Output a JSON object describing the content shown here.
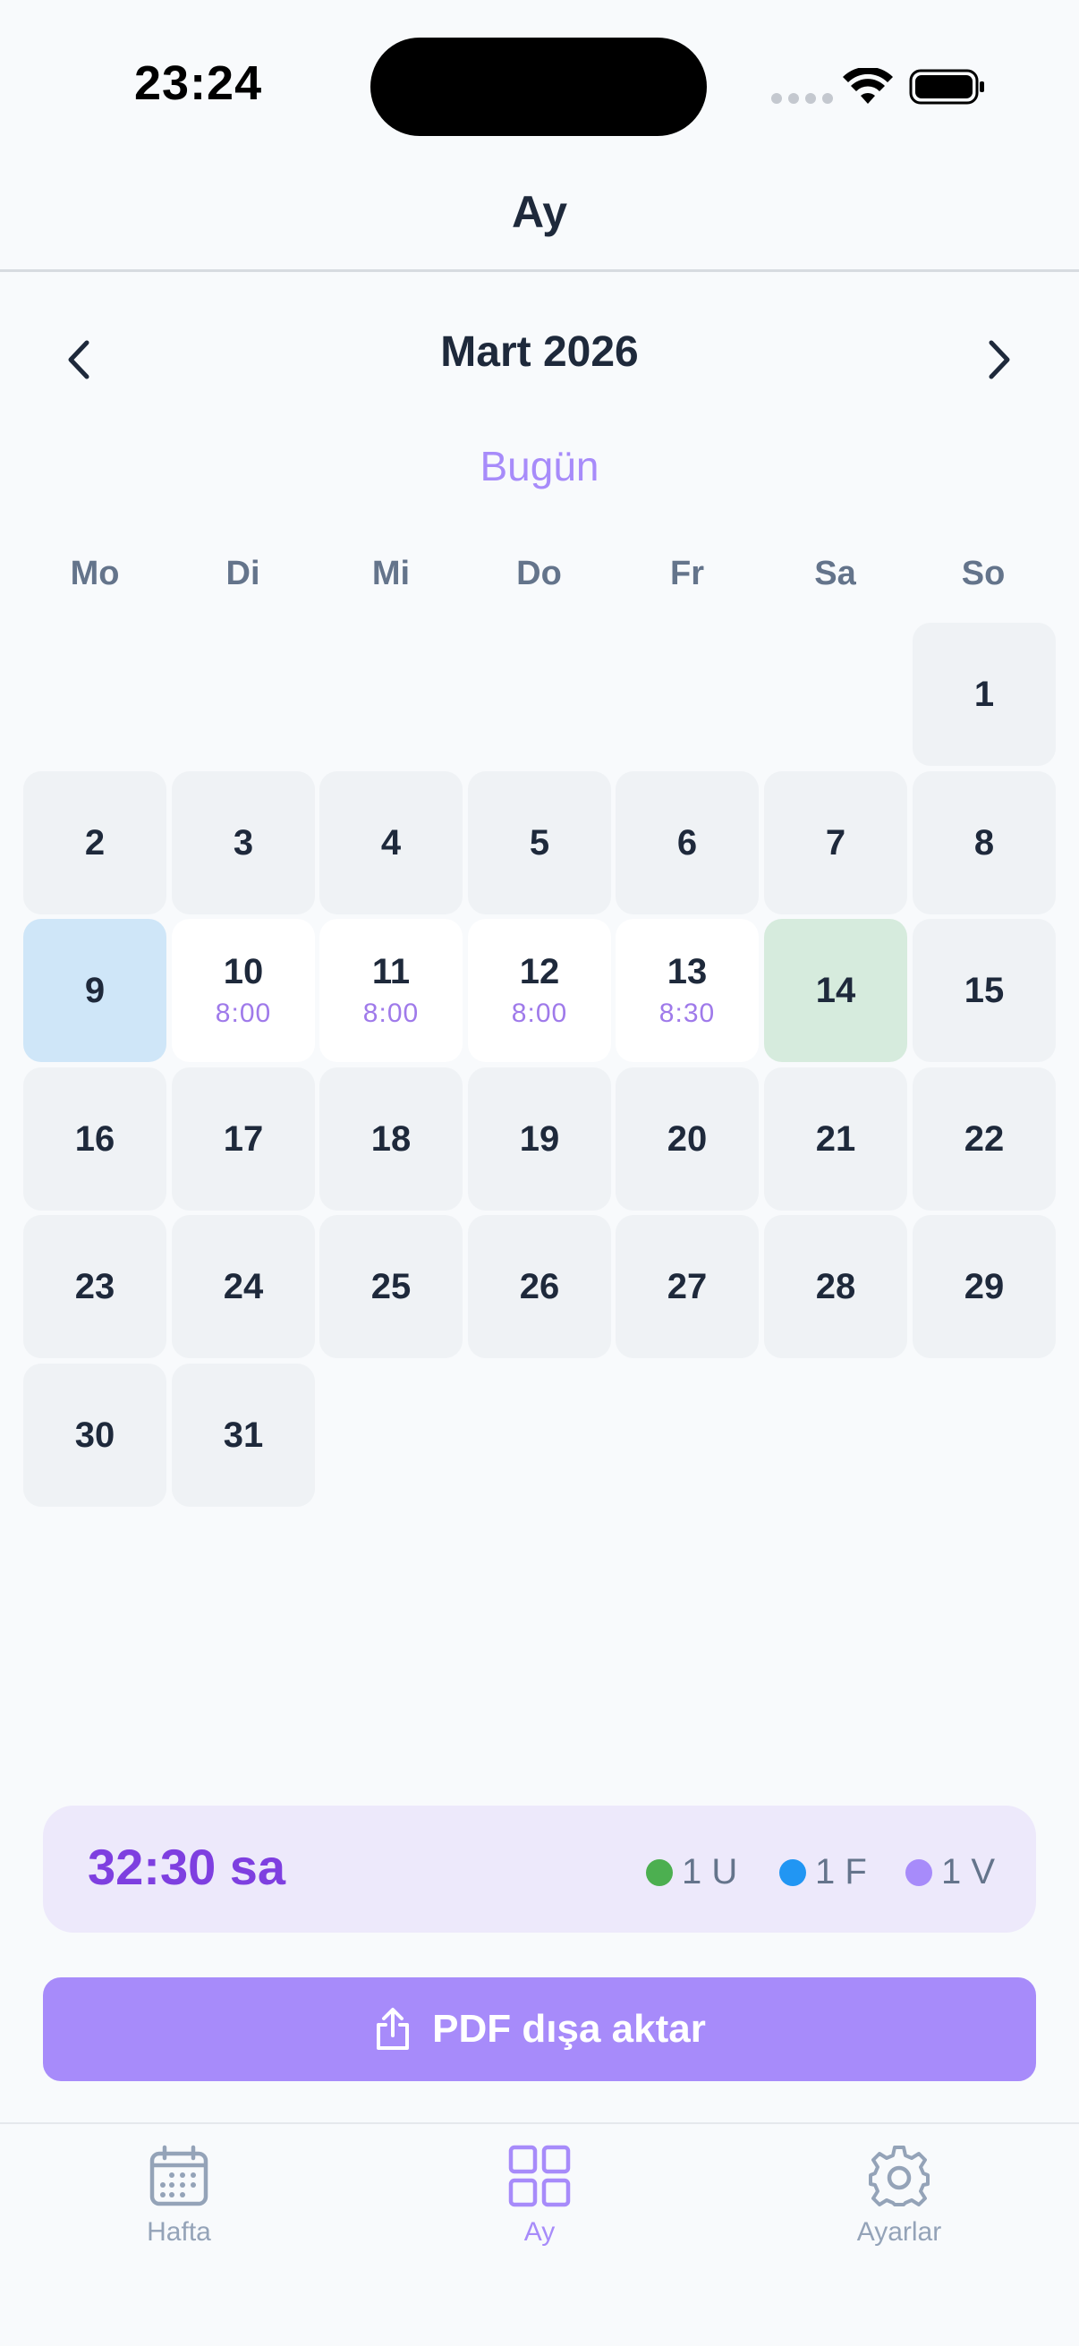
{
  "status_bar": {
    "time": "23:24"
  },
  "nav": {
    "title": "Ay"
  },
  "month_header": {
    "title": "Mart 2026",
    "today_label": "Bugün"
  },
  "weekdays": [
    "Mo",
    "Di",
    "Mi",
    "Do",
    "Fr",
    "Sa",
    "So"
  ],
  "calendar": {
    "days": [
      {
        "d": "1"
      },
      {
        "d": "2"
      },
      {
        "d": "3"
      },
      {
        "d": "4"
      },
      {
        "d": "5"
      },
      {
        "d": "6"
      },
      {
        "d": "7"
      },
      {
        "d": "8"
      },
      {
        "d": "9",
        "state": "today"
      },
      {
        "d": "10",
        "time": "8:00"
      },
      {
        "d": "11",
        "time": "8:00"
      },
      {
        "d": "12",
        "time": "8:00"
      },
      {
        "d": "13",
        "time": "8:30"
      },
      {
        "d": "14",
        "state": "green"
      },
      {
        "d": "15"
      },
      {
        "d": "16"
      },
      {
        "d": "17"
      },
      {
        "d": "18"
      },
      {
        "d": "19"
      },
      {
        "d": "20"
      },
      {
        "d": "21"
      },
      {
        "d": "22"
      },
      {
        "d": "23"
      },
      {
        "d": "24"
      },
      {
        "d": "25"
      },
      {
        "d": "26"
      },
      {
        "d": "27"
      },
      {
        "d": "28"
      },
      {
        "d": "29"
      },
      {
        "d": "30"
      },
      {
        "d": "31"
      }
    ]
  },
  "summary": {
    "total": "32:30 sa",
    "legend": [
      {
        "label": "1 U",
        "color": "#4caf50"
      },
      {
        "label": "1 F",
        "color": "#2196f3"
      },
      {
        "label": "1 V",
        "color": "#a78bfa"
      }
    ]
  },
  "export": {
    "label": "PDF dışa aktar"
  },
  "tabs": [
    {
      "label": "Hafta",
      "icon": "calendar-icon"
    },
    {
      "label": "Ay",
      "icon": "grid-icon",
      "active": true
    },
    {
      "label": "Ayarlar",
      "icon": "gear-icon"
    }
  ],
  "colors": {
    "accent": "#a78bfa",
    "today": "#cfe6f8",
    "highlight_green": "#d6ebdd",
    "cell": "#eff2f5"
  }
}
